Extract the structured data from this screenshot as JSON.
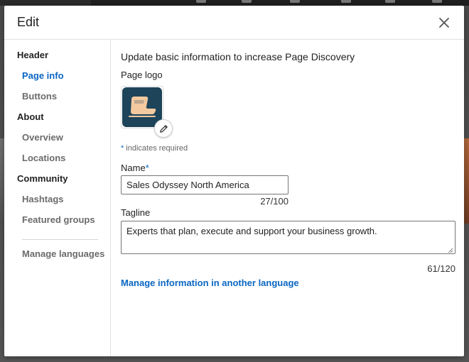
{
  "modal": {
    "title": "Edit"
  },
  "sidebar": {
    "sections": [
      {
        "heading": "Header",
        "items": [
          {
            "label": "Page info",
            "active": true
          },
          {
            "label": "Buttons",
            "active": false
          }
        ]
      },
      {
        "heading": "About",
        "items": [
          {
            "label": "Overview",
            "active": false
          },
          {
            "label": "Locations",
            "active": false
          }
        ]
      },
      {
        "heading": "Community",
        "items": [
          {
            "label": "Hashtags",
            "active": false
          },
          {
            "label": "Featured groups",
            "active": false
          }
        ]
      }
    ],
    "manage_languages": "Manage languages"
  },
  "content": {
    "intro": "Update basic information to increase Page Discovery",
    "logo_label": "Page logo",
    "required_star": "*",
    "required_note": "indicates required",
    "name_label": "Name",
    "name_value": "Sales Odyssey North America",
    "name_counter": "27/100",
    "tagline_label": "Tagline",
    "tagline_value": "Experts that plan, execute and support your business growth.",
    "tagline_counter": "61/120",
    "manage_link": "Manage information in another language"
  },
  "colors": {
    "accent": "#0a66c2",
    "logo_bg": "#1d4459",
    "logo_fg": "#f3c9a0"
  },
  "icons": {
    "close": "close-icon",
    "edit": "pencil-icon",
    "logo": "ship-logo-icon"
  }
}
